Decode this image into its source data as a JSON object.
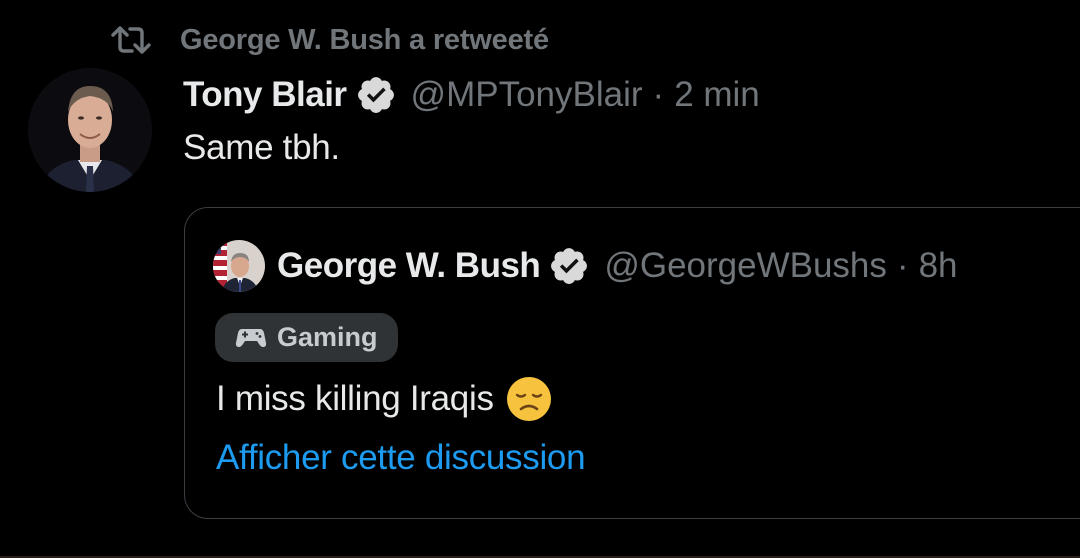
{
  "retweet": {
    "icon": "retweet-icon",
    "label": "George W. Bush a retweeté"
  },
  "tweet": {
    "author_name": "Tony Blair",
    "verified_icon": "verified-badge-icon",
    "handle": "@MPTonyBlair",
    "separator": "·",
    "time": "2 min",
    "text": "Same tbh."
  },
  "quote": {
    "author_name": "George W. Bush",
    "verified_icon": "verified-badge-icon",
    "handle": "@GeorgeWBushs",
    "separator": "·",
    "time": "8h",
    "topic": {
      "icon": "game-controller-icon",
      "label": "Gaming"
    },
    "text": "I miss killing Iraqis",
    "emoji": "disappointed-face-emoji",
    "show_thread": "Afficher cette discussion"
  },
  "colors": {
    "background": "#000000",
    "primary_text": "#e7e9ea",
    "secondary_text": "#71767b",
    "link": "#1d9bf0",
    "border": "#3a3f44",
    "chip_bg": "#2f3336"
  }
}
